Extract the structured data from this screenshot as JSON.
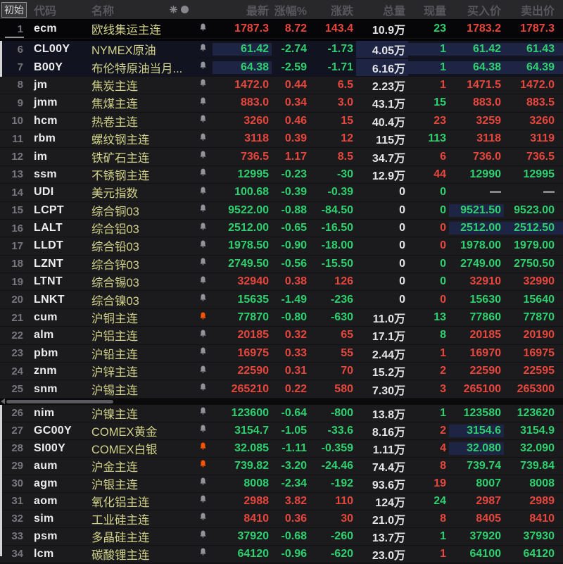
{
  "header": {
    "initial_label": "初始",
    "code_label": "代码",
    "name_label": "名称",
    "header_icons": [
      "spark-icon",
      "dot-icon"
    ],
    "value_columns": [
      "最新",
      "涨幅%",
      "涨跌",
      "总量",
      "现量",
      "买入价",
      "卖出价"
    ]
  },
  "colors": {
    "up_red": "#e8463c",
    "down_green": "#2ed06e",
    "neutral_white": "#e4e4e6",
    "flash_navy": "#1d2444",
    "bell_gray": "#93939a",
    "bell_orange": "#ff5300",
    "name_khaki": "#d2d28a",
    "header_bg": "#28282b",
    "row_bg": "#1b1b1e"
  },
  "rows": [
    {
      "num": "1",
      "code": "ecm",
      "name": "欧线集运主连",
      "bell": "gray",
      "pane": "top",
      "trend": "red",
      "latest": "1787.3",
      "pct": "8.72",
      "chg": "143.4",
      "vol": "10.9万",
      "cur": "23",
      "cur_color": "green",
      "buy": "1783.2",
      "sell": "1787.3",
      "flash": []
    },
    {
      "num": "6",
      "code": "CL00Y",
      "name": "NYMEX原油",
      "bell": "gray",
      "pane": "mid",
      "tint": true,
      "trend": "green",
      "latest": "61.42",
      "pct": "-2.74",
      "chg": "-1.73",
      "vol": "4.05万",
      "cur": "1",
      "cur_color": "green",
      "buy": "61.42",
      "sell": "61.43",
      "flash": [
        "latest",
        "vol",
        "cur",
        "buy",
        "sell"
      ]
    },
    {
      "num": "7",
      "code": "B00Y",
      "name": "布伦特原油当月...",
      "bell": "gray",
      "pane": "mid",
      "tint": true,
      "trend": "green",
      "latest": "64.38",
      "pct": "-2.59",
      "chg": "-1.71",
      "vol": "6.16万",
      "cur": "1",
      "cur_color": "green",
      "buy": "64.38",
      "sell": "64.39",
      "flash": [
        "latest",
        "vol",
        "cur",
        "buy",
        "sell"
      ]
    },
    {
      "num": "8",
      "code": "jm",
      "name": "焦炭主连",
      "bell": "gray",
      "pane": "mid",
      "trend": "red",
      "latest": "1472.0",
      "pct": "0.44",
      "chg": "6.5",
      "vol": "2.23万",
      "cur": "1",
      "cur_color": "red",
      "buy": "1471.5",
      "sell": "1472.0",
      "flash": []
    },
    {
      "num": "9",
      "code": "jmm",
      "name": "焦煤主连",
      "bell": "gray",
      "pane": "mid",
      "trend": "red",
      "latest": "883.0",
      "pct": "0.34",
      "chg": "3.0",
      "vol": "43.1万",
      "cur": "15",
      "cur_color": "green",
      "buy": "883.0",
      "sell": "883.5",
      "flash": []
    },
    {
      "num": "10",
      "code": "hcm",
      "name": "热卷主连",
      "bell": "gray",
      "pane": "mid",
      "trend": "red",
      "latest": "3260",
      "pct": "0.46",
      "chg": "15",
      "vol": "40.4万",
      "cur": "23",
      "cur_color": "red",
      "buy": "3259",
      "sell": "3260",
      "flash": []
    },
    {
      "num": "11",
      "code": "rbm",
      "name": "螺纹钢主连",
      "bell": "gray",
      "pane": "mid",
      "trend": "red",
      "latest": "3118",
      "pct": "0.39",
      "chg": "12",
      "vol": "115万",
      "cur": "113",
      "cur_color": "green",
      "buy": "3118",
      "sell": "3119",
      "flash": []
    },
    {
      "num": "12",
      "code": "im",
      "name": "铁矿石主连",
      "bell": "gray",
      "pane": "mid",
      "trend": "red",
      "latest": "736.5",
      "pct": "1.17",
      "chg": "8.5",
      "vol": "34.7万",
      "cur": "6",
      "cur_color": "red",
      "buy": "736.0",
      "sell": "736.5",
      "flash": []
    },
    {
      "num": "13",
      "code": "ssm",
      "name": "不锈钢主连",
      "bell": "gray",
      "pane": "mid",
      "trend": "green",
      "latest": "12995",
      "pct": "-0.23",
      "chg": "-30",
      "vol": "12.9万",
      "cur": "44",
      "cur_color": "red",
      "buy": "12990",
      "sell": "12995",
      "flash": []
    },
    {
      "num": "14",
      "code": "UDI",
      "name": "美元指数",
      "bell": "gray",
      "pane": "mid",
      "trend": "green",
      "latest": "100.68",
      "pct": "-0.39",
      "chg": "-0.39",
      "vol": "0",
      "cur": "0",
      "cur_color": "green",
      "buy": "—",
      "sell": "—",
      "buy_color": "white",
      "sell_color": "white",
      "flash": []
    },
    {
      "num": "15",
      "code": "LCPT",
      "name": "综合铜03",
      "bell": "gray",
      "pane": "mid",
      "trend": "green",
      "latest": "9522.00",
      "pct": "-0.88",
      "chg": "-84.50",
      "vol": "0",
      "cur": "0",
      "cur_color": "green",
      "buy": "9521.50",
      "sell": "9523.00",
      "flash": [
        "buy"
      ]
    },
    {
      "num": "16",
      "code": "LALT",
      "name": "综合铝03",
      "bell": "gray",
      "pane": "mid",
      "trend": "green",
      "latest": "2512.00",
      "pct": "-0.65",
      "chg": "-16.50",
      "vol": "0",
      "cur": "0",
      "cur_color": "red",
      "buy": "2512.00",
      "sell": "2512.50",
      "flash": [
        "buy",
        "sell"
      ]
    },
    {
      "num": "17",
      "code": "LLDT",
      "name": "综合铅03",
      "bell": "gray",
      "pane": "mid",
      "trend": "green",
      "latest": "1978.50",
      "pct": "-0.90",
      "chg": "-18.00",
      "vol": "0",
      "cur": "0",
      "cur_color": "red",
      "buy": "1978.00",
      "sell": "1979.00",
      "flash": []
    },
    {
      "num": "18",
      "code": "LZNT",
      "name": "综合锌03",
      "bell": "gray",
      "pane": "mid",
      "trend": "green",
      "latest": "2749.50",
      "pct": "-0.56",
      "chg": "-15.50",
      "vol": "0",
      "cur": "0",
      "cur_color": "green",
      "buy": "2749.00",
      "sell": "2750.50",
      "flash": []
    },
    {
      "num": "19",
      "code": "LTNT",
      "name": "综合锡03",
      "bell": "gray",
      "pane": "mid",
      "trend": "red",
      "latest": "32940",
      "pct": "0.38",
      "chg": "126",
      "vol": "0",
      "cur": "0",
      "cur_color": "green",
      "buy": "32910",
      "sell": "32990",
      "flash": []
    },
    {
      "num": "20",
      "code": "LNKT",
      "name": "综合镍03",
      "bell": "gray",
      "pane": "mid",
      "trend": "green",
      "latest": "15635",
      "pct": "-1.49",
      "chg": "-236",
      "vol": "0",
      "cur": "0",
      "cur_color": "red",
      "buy": "15630",
      "sell": "15640",
      "flash": []
    },
    {
      "num": "21",
      "code": "cum",
      "name": "沪铜主连",
      "bell": "orange",
      "pane": "mid",
      "trend": "green",
      "latest": "77870",
      "pct": "-0.80",
      "chg": "-630",
      "vol": "11.0万",
      "cur": "13",
      "cur_color": "green",
      "buy": "77860",
      "sell": "77870",
      "flash": []
    },
    {
      "num": "22",
      "code": "alm",
      "name": "沪铝主连",
      "bell": "gray",
      "pane": "mid",
      "trend": "red",
      "latest": "20185",
      "pct": "0.32",
      "chg": "65",
      "vol": "17.1万",
      "cur": "8",
      "cur_color": "green",
      "buy": "20185",
      "sell": "20190",
      "flash": []
    },
    {
      "num": "23",
      "code": "pbm",
      "name": "沪铅主连",
      "bell": "gray",
      "pane": "mid",
      "trend": "red",
      "latest": "16975",
      "pct": "0.33",
      "chg": "55",
      "vol": "2.44万",
      "cur": "1",
      "cur_color": "red",
      "buy": "16970",
      "sell": "16975",
      "flash": []
    },
    {
      "num": "24",
      "code": "znm",
      "name": "沪锌主连",
      "bell": "gray",
      "pane": "mid",
      "trend": "red",
      "latest": "22590",
      "pct": "0.31",
      "chg": "70",
      "vol": "15.2万",
      "cur": "2",
      "cur_color": "red",
      "buy": "22590",
      "sell": "22595",
      "flash": []
    },
    {
      "num": "25",
      "code": "snm",
      "name": "沪锡主连",
      "bell": "gray",
      "pane": "mid",
      "trend": "red",
      "latest": "265210",
      "pct": "0.22",
      "chg": "580",
      "vol": "7.30万",
      "cur": "3",
      "cur_color": "red",
      "buy": "265100",
      "sell": "265300",
      "flash": []
    },
    {
      "num": "26",
      "code": "nim",
      "name": "沪镍主连",
      "bell": "gray",
      "pane": "bot",
      "trend": "green",
      "latest": "123600",
      "pct": "-0.64",
      "chg": "-800",
      "vol": "13.8万",
      "cur": "1",
      "cur_color": "green",
      "buy": "123580",
      "sell": "123620",
      "flash": []
    },
    {
      "num": "27",
      "code": "GC00Y",
      "name": "COMEX黄金",
      "bell": "gray",
      "pane": "bot",
      "trend": "green",
      "latest": "3154.7",
      "pct": "-1.05",
      "chg": "-33.6",
      "vol": "8.16万",
      "cur": "2",
      "cur_color": "red",
      "buy": "3154.6",
      "sell": "3154.9",
      "flash": [
        "buy"
      ]
    },
    {
      "num": "28",
      "code": "SI00Y",
      "name": "COMEX白银",
      "bell": "orange",
      "pane": "bot",
      "trend": "green",
      "latest": "32.085",
      "pct": "-1.11",
      "chg": "-0.359",
      "vol": "1.11万",
      "cur": "4",
      "cur_color": "red",
      "buy": "32.080",
      "sell": "32.090",
      "flash": [
        "buy"
      ]
    },
    {
      "num": "29",
      "code": "aum",
      "name": "沪金主连",
      "bell": "orange",
      "pane": "bot",
      "trend": "green",
      "latest": "739.82",
      "pct": "-3.20",
      "chg": "-24.46",
      "vol": "74.4万",
      "cur": "8",
      "cur_color": "red",
      "buy": "739.74",
      "sell": "739.84",
      "flash": []
    },
    {
      "num": "30",
      "code": "agm",
      "name": "沪银主连",
      "bell": "gray",
      "pane": "bot",
      "trend": "green",
      "latest": "8008",
      "pct": "-2.34",
      "chg": "-192",
      "vol": "93.6万",
      "cur": "19",
      "cur_color": "red",
      "buy": "8007",
      "sell": "8008",
      "flash": []
    },
    {
      "num": "31",
      "code": "aom",
      "name": "氧化铝主连",
      "bell": "gray",
      "pane": "bot",
      "trend": "red",
      "latest": "2988",
      "pct": "3.82",
      "chg": "110",
      "vol": "124万",
      "cur": "24",
      "cur_color": "green",
      "buy": "2987",
      "sell": "2989",
      "flash": []
    },
    {
      "num": "32",
      "code": "sim",
      "name": "工业硅主连",
      "bell": "gray",
      "pane": "bot",
      "trend": "red",
      "latest": "8410",
      "pct": "0.36",
      "chg": "30",
      "vol": "21.0万",
      "cur": "8",
      "cur_color": "red",
      "buy": "8405",
      "sell": "8410",
      "flash": []
    },
    {
      "num": "33",
      "code": "psm",
      "name": "多晶硅主连",
      "bell": "gray",
      "pane": "bot",
      "trend": "green",
      "latest": "37920",
      "pct": "-0.68",
      "chg": "-260",
      "vol": "13.7万",
      "cur": "1",
      "cur_color": "green",
      "buy": "37920",
      "sell": "37930",
      "flash": []
    },
    {
      "num": "34",
      "code": "lcm",
      "name": "碳酸锂主连",
      "bell": "gray",
      "pane": "bot",
      "trend": "green",
      "latest": "64120",
      "pct": "-0.96",
      "chg": "-620",
      "vol": "23.0万",
      "cur": "1",
      "cur_color": "red",
      "buy": "64100",
      "sell": "64120",
      "flash": []
    }
  ]
}
